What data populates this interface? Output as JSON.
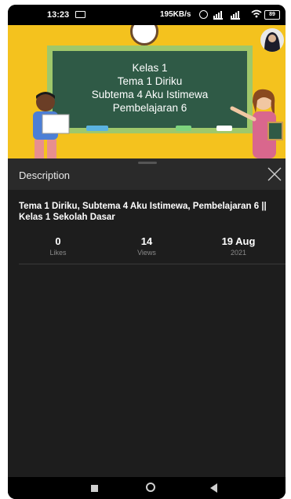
{
  "status_bar": {
    "time": "13:23",
    "network_speed": "195KB/s",
    "battery": "89"
  },
  "video": {
    "board_lines": [
      "Kelas 1",
      "Tema 1 Diriku",
      "Subtema 4 Aku Istimewa",
      "Pembelajaran 6"
    ]
  },
  "description_panel": {
    "title": "Description",
    "video_title": "Tema 1 Diriku, Subtema 4 Aku Istimewa, Pembelajaran 6 || Kelas 1 Sekolah Dasar",
    "stats": {
      "likes_value": "0",
      "likes_label": "Likes",
      "views_value": "14",
      "views_label": "Views",
      "date_value": "19 Aug",
      "date_label": "2021"
    }
  },
  "colors": {
    "video_background": "#f4c21e",
    "chalkboard": "#2f5a46",
    "board_frame": "#9fc86b",
    "panel_background": "#1d1d1d"
  },
  "icons": [
    "screen-cast-icon",
    "alarm-icon",
    "signal-icon",
    "wifi-icon",
    "battery-icon",
    "close-icon",
    "nav-recents-icon",
    "nav-home-icon",
    "nav-back-icon"
  ]
}
